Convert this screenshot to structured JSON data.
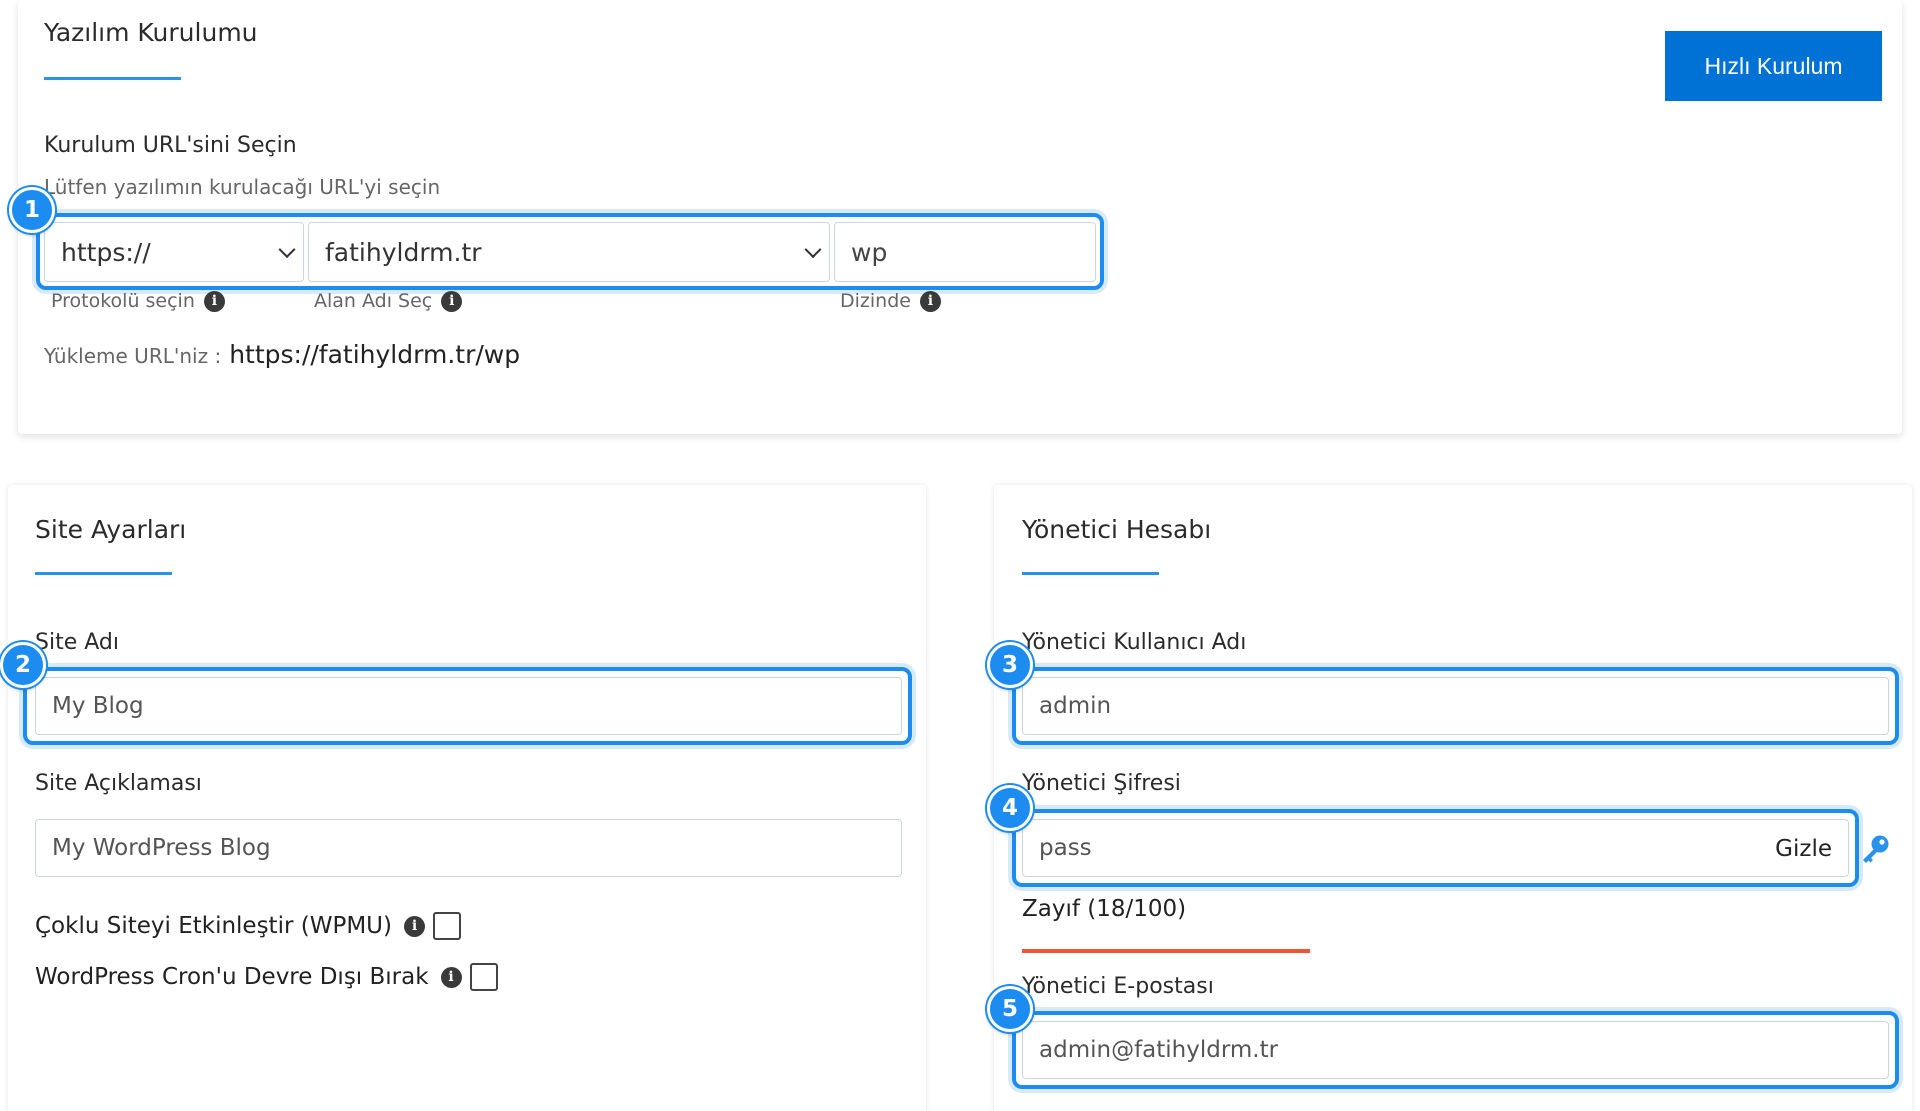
{
  "install": {
    "title": "Yazılım Kurulumu",
    "quick_install_label": "Hızlı Kurulum",
    "url_label": "Kurulum URL'sini Seçin",
    "url_hint": "Lütfen yazılımın kurulacağı URL'yi seçin",
    "protocol_value": "https://",
    "domain_value": "fatihyldrm.tr",
    "directory_value": "wp",
    "protocol_caption": "Protokolü seçin",
    "domain_caption": "Alan Adı Seç",
    "directory_caption": "Dizinde",
    "install_url_prefix": "Yükleme URL'niz :",
    "install_url_value": "https://fatihyldrm.tr/wp"
  },
  "site": {
    "title": "Site Ayarları",
    "name_label": "Site Adı",
    "name_value": "My Blog",
    "description_label": "Site Açıklaması",
    "description_value": "My WordPress Blog",
    "multisite_label": "Çoklu Siteyi Etkinleştir (WPMU)",
    "multisite_checked": false,
    "cron_label": "WordPress Cron'u Devre Dışı Bırak",
    "cron_checked": false
  },
  "admin": {
    "title": "Yönetici Hesabı",
    "username_label": "Yönetici Kullanıcı Adı",
    "username_value": "admin",
    "password_label": "Yönetici Şifresi",
    "password_value": "pass",
    "hide_label": "Gizle",
    "strength_text": "Zayıf (18/100)",
    "strength_score": 18,
    "strength_color": "#ee5533",
    "email_label": "Yönetici E-postası",
    "email_value": "admin@fatihyldrm.tr"
  },
  "badges": [
    "1",
    "2",
    "3",
    "4",
    "5"
  ],
  "icons": {
    "info": "info-icon",
    "key": "key-icon",
    "dropdown": "chevron-down-icon"
  },
  "colors": {
    "accent": "#1d8cf0",
    "button": "#0072d6",
    "underline": "#2a93e8"
  }
}
